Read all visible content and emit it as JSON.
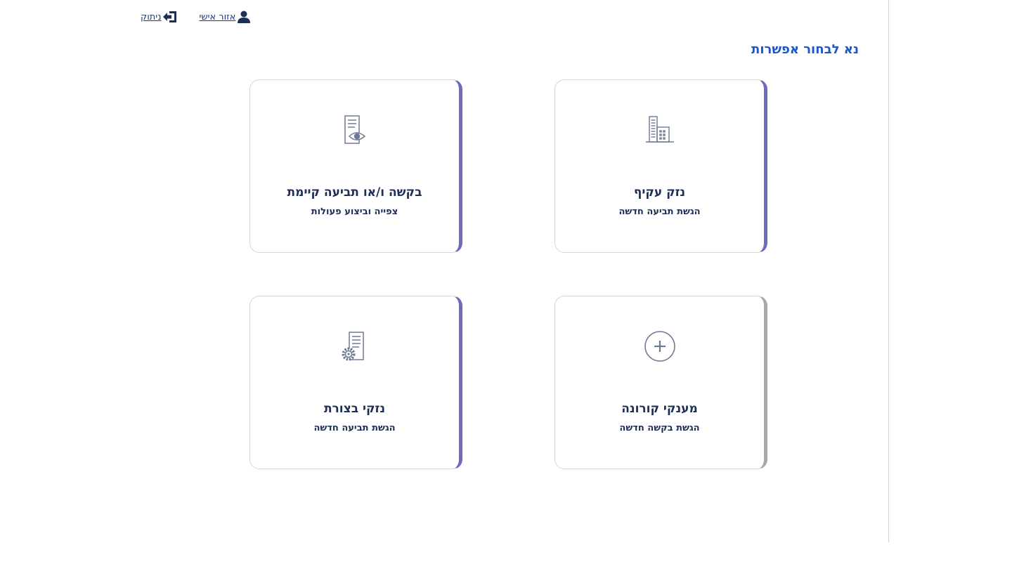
{
  "header": {
    "personal_area_label": "אזור אישי",
    "logout_label": "ניתוק",
    "personal_area_icon": "user-icon",
    "logout_icon": "logout-icon"
  },
  "page_title": "נא לבחור אפשרות",
  "cards": [
    {
      "title": "נזק עקיף",
      "subtitle": "הגשת תביעה חדשה",
      "icon": "building-icon",
      "accent": "#6b6cbf"
    },
    {
      "title": "בקשה ו/או תביעה קיימת",
      "subtitle": "צפייה וביצוע פעולות",
      "icon": "document-eye-icon",
      "accent": "#6b6cbf"
    },
    {
      "title": "מענקי קורונה",
      "subtitle": "הגשת בקשה חדשה",
      "icon": "plus-circle-icon",
      "accent": "#a8a8a8"
    },
    {
      "title": "נזקי בצורת",
      "subtitle": "הגשת תביעה חדשה",
      "icon": "document-gear-icon",
      "accent": "#6b6cbf"
    }
  ],
  "colors": {
    "title_blue": "#1c56c9",
    "text_navy": "#1e2f55",
    "link_blue": "#1a3c84"
  }
}
